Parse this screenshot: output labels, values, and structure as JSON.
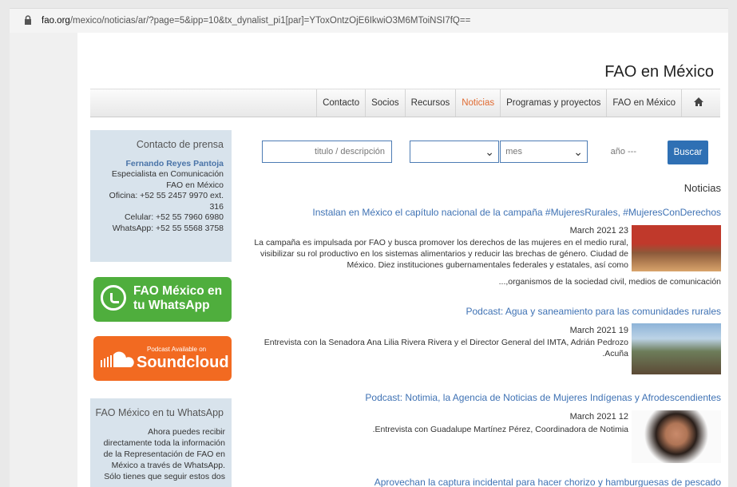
{
  "browser": {
    "url_host": "fao.org",
    "url_path": "/mexico/noticias/ar/?page=5&ipp=10&tx_dynalist_pi1[par]=YToxOntzOjE6IkwiO3M6MToiNSI7fQ=="
  },
  "header": {
    "brand": "FAO en México"
  },
  "nav": {
    "items": [
      "Contacto",
      "Socios",
      "Recursos",
      "Noticias",
      "Programas y proyectos",
      "FAO en México"
    ],
    "active": "Noticias",
    "home_icon": "home-icon"
  },
  "press": {
    "title": "Contacto de prensa",
    "name": "Fernando Reyes Pantoja",
    "lines": [
      "Especialista en Comunicación",
      "FAO en México",
      "Oficina: +52 55 2457 9970 ext.",
      "316",
      "Celular: +52 55 7960 6980",
      "WhatsApp: +52 55 5568 3758"
    ]
  },
  "banners": {
    "whatsapp_line1": "FAO México en",
    "whatsapp_line2": "tu WhatsApp",
    "soundcloud_small": "Podcast Available on",
    "soundcloud_big": "Soundcloud"
  },
  "whatsapp_box": {
    "title": "FAO México en tu WhatsApp",
    "text": "Ahora puedes recibir directamente toda la información de la Representación de FAO en México a través de WhatsApp. Sólo tienes que seguir estos dos"
  },
  "filters": {
    "search_placeholder": "titulo / descripción",
    "month_label": "mes",
    "year_label": "año ---",
    "search_button": "Buscar"
  },
  "section_title": "Noticias",
  "articles": [
    {
      "title": "Instalan en México el capítulo nacional de la campaña #MujeresRurales, #MujeresConDerechos",
      "date": "March 2021 23",
      "summary": "La campaña es impulsada por FAO y busca promover los derechos de las mujeres en el medio rural, visibilizar su rol productivo en los sistemas alimentarios y reducir las brechas de género. Ciudad de México. Diez instituciones gubernamentales federales y estatales, así como",
      "continuation": "...,organismos de la sociedad civil, medios de comunicación"
    },
    {
      "title": "Podcast: Agua y saneamiento para las comunidades rurales",
      "date": "March 2021 19",
      "summary": "Entrevista con la Senadora Ana Lilia Rivera Rivera y el Director General del IMTA, Adrián Pedrozo .Acuña"
    },
    {
      "title": "Podcast: Notimia, la Agencia de Noticias de Mujeres Indígenas y Afrodescendientes",
      "date": "March 2021 12",
      "summary": ".Entrevista con Guadalupe Martínez Pérez, Coordinadora de Notimia"
    },
    {
      "title": "Aprovechan la captura incidental para hacer chorizo y hamburguesas de pescado"
    }
  ]
}
